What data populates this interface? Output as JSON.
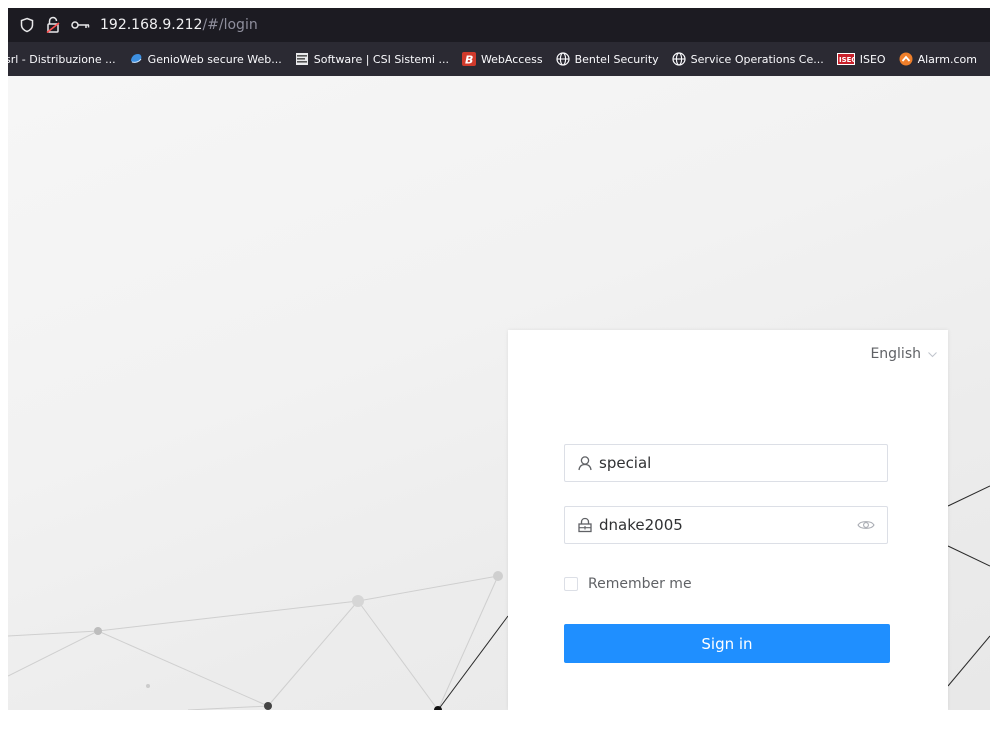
{
  "browser": {
    "url_host": "192.168.9.212",
    "url_path": "/#/login",
    "bookmarks": [
      {
        "label": "srl - Distribuzione ...",
        "icon": "none"
      },
      {
        "label": "GenioWeb secure Web...",
        "icon": "genio-icon"
      },
      {
        "label": "Software | CSI Sistemi ...",
        "icon": "csi-icon"
      },
      {
        "label": "WebAccess",
        "icon": "webaccess-icon"
      },
      {
        "label": "Bentel Security",
        "icon": "globe-icon"
      },
      {
        "label": "Service Operations Ce...",
        "icon": "globe-icon"
      },
      {
        "label": "ISEO",
        "icon": "iseo-icon"
      },
      {
        "label": "Alarm.com",
        "icon": "alarm-icon"
      }
    ]
  },
  "login": {
    "language": "English",
    "username": "special",
    "password": "dnake2005",
    "remember_label": "Remember me",
    "remember_checked": false,
    "signin_label": "Sign in"
  },
  "colors": {
    "accent": "#1f8fff",
    "urlbar_bg": "#1c1b22",
    "bookmarks_bg": "#2b2a33",
    "webaccess_icon": "#d03a2c",
    "alarm_icon": "#f07f2a"
  }
}
